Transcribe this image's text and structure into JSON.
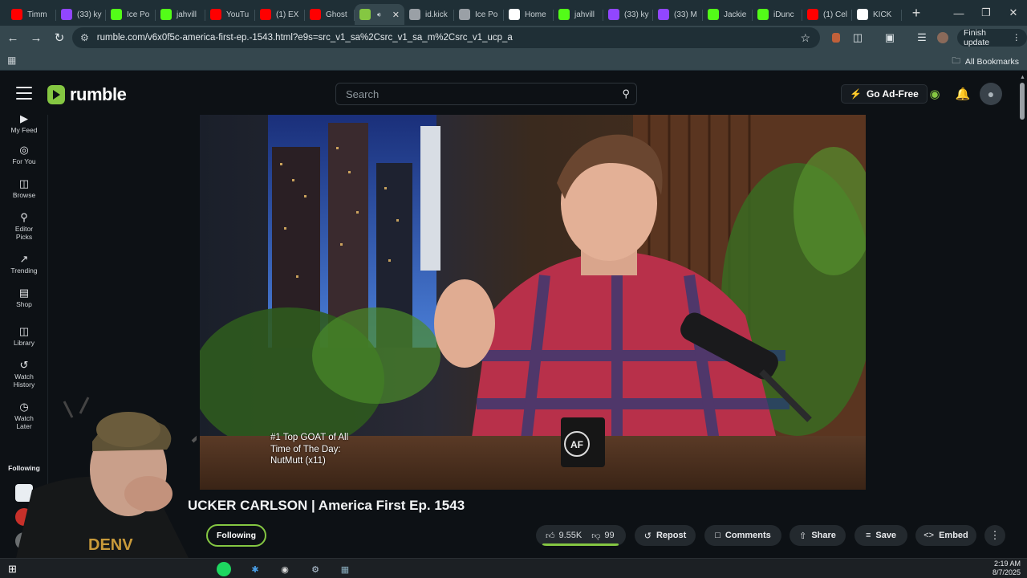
{
  "browser": {
    "tabs": [
      {
        "title": "Timm",
        "icon": "youtube-icon",
        "color": "#ff0000"
      },
      {
        "title": "(33) ky",
        "icon": "twitch-icon",
        "color": "#9146ff"
      },
      {
        "title": "Ice Po",
        "icon": "kick-icon",
        "color": "#53fc18"
      },
      {
        "title": "jahvill",
        "icon": "kick-icon",
        "color": "#53fc18"
      },
      {
        "title": "YouTu",
        "icon": "youtube-icon",
        "color": "#ff0000"
      },
      {
        "title": "(1) EX",
        "icon": "youtube-icon",
        "color": "#ff0000"
      },
      {
        "title": "Ghost",
        "icon": "youtube-icon",
        "color": "#ff0000"
      },
      {
        "title": "",
        "icon": "rumble-icon",
        "color": "#85c742",
        "active": true
      },
      {
        "title": "id.kick",
        "icon": "globe-icon",
        "color": "#9aa0a6"
      },
      {
        "title": "Ice Po",
        "icon": "globe-icon",
        "color": "#9aa0a6"
      },
      {
        "title": "Home",
        "icon": "x-icon",
        "color": "#ffffff"
      },
      {
        "title": "jahvill",
        "icon": "kick-icon",
        "color": "#53fc18"
      },
      {
        "title": "(33) ky",
        "icon": "twitch-icon",
        "color": "#9146ff"
      },
      {
        "title": "(33) M",
        "icon": "twitch-icon",
        "color": "#9146ff"
      },
      {
        "title": "Jackie",
        "icon": "kick-icon",
        "color": "#53fc18"
      },
      {
        "title": "iDunc",
        "icon": "kick-icon",
        "color": "#53fc18"
      },
      {
        "title": "(1) Cel",
        "icon": "youtube-icon",
        "color": "#ff0000"
      },
      {
        "title": "KICK",
        "icon": "x-icon",
        "color": "#ffffff"
      }
    ],
    "url": "rumble.com/v6x0f5c-america-first-ep.-1543.html?e9s=src_v1_sa%2Csrc_v1_sa_m%2Csrc_v1_ucp_a",
    "finish_update": "Finish update",
    "all_bookmarks": "All Bookmarks"
  },
  "rumble": {
    "logo": "rumble",
    "search_placeholder": "Search",
    "go_ad_free": "Go Ad-Free",
    "sidebar": [
      {
        "label": "My Feed",
        "icon": "feed-icon"
      },
      {
        "label": "For You",
        "icon": "target-icon"
      },
      {
        "label": "Browse",
        "icon": "browse-icon"
      },
      {
        "label": "Editor Picks",
        "icon": "ribbon-icon"
      },
      {
        "label": "Trending",
        "icon": "trending-icon"
      },
      {
        "label": "Shop",
        "icon": "shop-icon"
      },
      {
        "label": "Library",
        "icon": "library-icon"
      },
      {
        "label": "Watch History",
        "icon": "history-icon"
      },
      {
        "label": "Watch Later",
        "icon": "clock-icon"
      }
    ],
    "following_label": "Following",
    "video": {
      "title": "UCKER CARLSON | America First Ep. 1543",
      "caption": "#1 Top GOAT of All Time of The Day: NutMutt (x11)",
      "follow_button": "Following",
      "likes": "9.55K",
      "dislikes": "99",
      "like_ratio": 0.99,
      "actions": [
        "Repost",
        "Comments",
        "Share",
        "Save",
        "Embed"
      ]
    }
  },
  "taskbar": {
    "time": "2:19 AM",
    "date": "8/7/2025"
  },
  "colors": {
    "accent": "#85c742",
    "background": "#0d1115"
  }
}
